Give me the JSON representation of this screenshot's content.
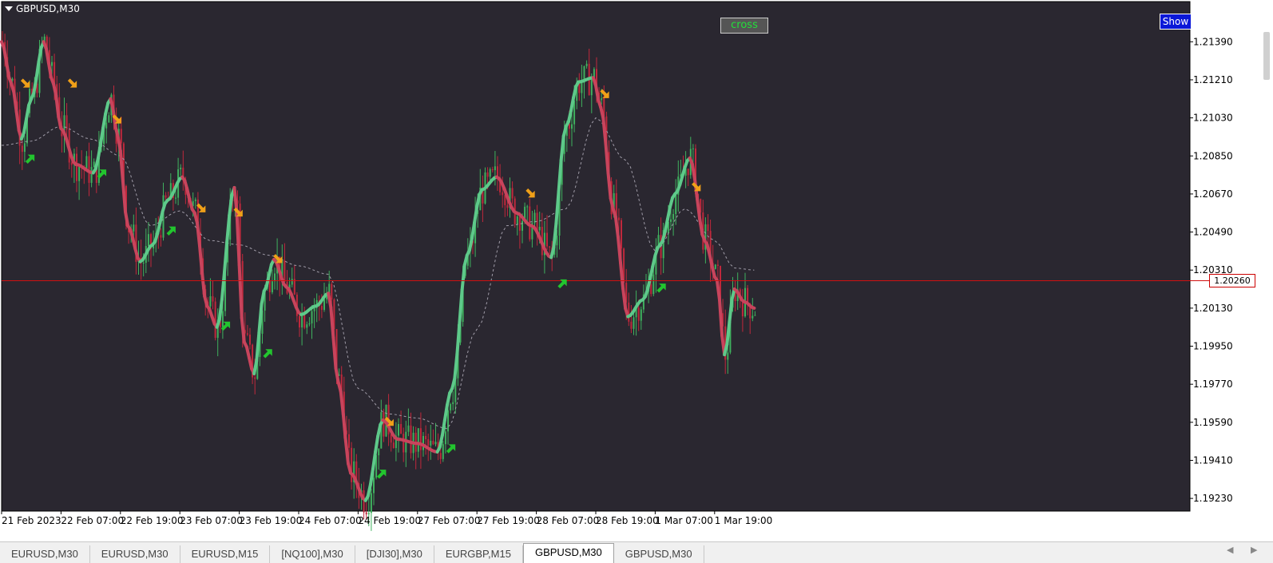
{
  "chart_title": "GBPUSD,M30",
  "show_button_label": "Show",
  "cross_label": "cross",
  "current_price_label": "1.20260",
  "colors": {
    "background": "#2a2730",
    "frame": "#ffffff",
    "axis_text": "#000000",
    "hline": "#d01010",
    "bull_candle": "#3fb15e",
    "bear_candle": "#c0283c",
    "trend_up": "#5ec98a",
    "trend_down": "#c8445c",
    "signal_buy": "#22c52e",
    "signal_sell": "#f0a018",
    "dashed_ma": "#a09ca8",
    "active_tab": "#ffffff"
  },
  "chart_data": {
    "type": "candlestick",
    "symbol": "GBPUSD",
    "timeframe": "M30",
    "y_ticks": [
      "1.21390",
      "1.21210",
      "1.21030",
      "1.20850",
      "1.20670",
      "1.20490",
      "1.20310",
      "1.20130",
      "1.19950",
      "1.19770",
      "1.19590",
      "1.19410",
      "1.19230"
    ],
    "ylim": [
      1.1917,
      1.2158
    ],
    "x_ticks": [
      "21 Feb 2023",
      "22 Feb 07:00",
      "22 Feb 19:00",
      "23 Feb 07:00",
      "23 Feb 19:00",
      "24 Feb 07:00",
      "24 Feb 19:00",
      "27 Feb 07:00",
      "27 Feb 19:00",
      "28 Feb 07:00",
      "28 Feb 19:00",
      "1 Mar 07:00",
      "1 Mar 19:00"
    ],
    "bars_per_tick": 24,
    "current_price": 1.2026,
    "smooth_line": [
      {
        "bar": 0,
        "price": 1.2139
      },
      {
        "bar": 4,
        "price": 1.2119
      },
      {
        "bar": 8,
        "price": 1.2093
      },
      {
        "bar": 12,
        "price": 1.2112
      },
      {
        "bar": 17,
        "price": 1.2139
      },
      {
        "bar": 21,
        "price": 1.2119
      },
      {
        "bar": 24,
        "price": 1.2098
      },
      {
        "bar": 30,
        "price": 1.2081
      },
      {
        "bar": 37,
        "price": 1.2077
      },
      {
        "bar": 44,
        "price": 1.2112
      },
      {
        "bar": 47,
        "price": 1.2094
      },
      {
        "bar": 51,
        "price": 1.2052
      },
      {
        "bar": 56,
        "price": 1.2035
      },
      {
        "bar": 61,
        "price": 1.2043
      },
      {
        "bar": 67,
        "price": 1.2064
      },
      {
        "bar": 73,
        "price": 1.2075
      },
      {
        "bar": 78,
        "price": 1.2058
      },
      {
        "bar": 83,
        "price": 1.2014
      },
      {
        "bar": 87,
        "price": 1.2004
      },
      {
        "bar": 94,
        "price": 1.207
      },
      {
        "bar": 98,
        "price": 1.1997
      },
      {
        "bar": 102,
        "price": 1.1982
      },
      {
        "bar": 106,
        "price": 1.2021
      },
      {
        "bar": 110,
        "price": 1.2036
      },
      {
        "bar": 115,
        "price": 1.2023
      },
      {
        "bar": 121,
        "price": 1.201
      },
      {
        "bar": 127,
        "price": 1.2014
      },
      {
        "bar": 132,
        "price": 1.202
      },
      {
        "bar": 136,
        "price": 1.1978
      },
      {
        "bar": 141,
        "price": 1.1935
      },
      {
        "bar": 147,
        "price": 1.1922
      },
      {
        "bar": 154,
        "price": 1.196
      },
      {
        "bar": 160,
        "price": 1.1951
      },
      {
        "bar": 168,
        "price": 1.1949
      },
      {
        "bar": 176,
        "price": 1.1945
      },
      {
        "bar": 182,
        "price": 1.1975
      },
      {
        "bar": 188,
        "price": 1.2038
      },
      {
        "bar": 194,
        "price": 1.2069
      },
      {
        "bar": 200,
        "price": 1.2075
      },
      {
        "bar": 208,
        "price": 1.2058
      },
      {
        "bar": 214,
        "price": 1.2052
      },
      {
        "bar": 222,
        "price": 1.2037
      },
      {
        "bar": 228,
        "price": 1.2099
      },
      {
        "bar": 233,
        "price": 1.212
      },
      {
        "bar": 239,
        "price": 1.2122
      },
      {
        "bar": 242,
        "price": 1.2108
      },
      {
        "bar": 247,
        "price": 1.206
      },
      {
        "bar": 253,
        "price": 1.2009
      },
      {
        "bar": 259,
        "price": 1.2017
      },
      {
        "bar": 266,
        "price": 1.2043
      },
      {
        "bar": 272,
        "price": 1.2067
      },
      {
        "bar": 278,
        "price": 1.2084
      },
      {
        "bar": 284,
        "price": 1.2045
      },
      {
        "bar": 289,
        "price": 1.2026
      },
      {
        "bar": 292,
        "price": 1.1991
      },
      {
        "bar": 296,
        "price": 1.2022
      },
      {
        "bar": 300,
        "price": 1.2016
      },
      {
        "bar": 304,
        "price": 1.2013
      }
    ],
    "slow_line": [
      {
        "bar": 0,
        "price": 1.209
      },
      {
        "bar": 12,
        "price": 1.2092
      },
      {
        "bar": 24,
        "price": 1.2099
      },
      {
        "bar": 36,
        "price": 1.2093
      },
      {
        "bar": 48,
        "price": 1.2085
      },
      {
        "bar": 60,
        "price": 1.2052
      },
      {
        "bar": 72,
        "price": 1.2059
      },
      {
        "bar": 84,
        "price": 1.2045
      },
      {
        "bar": 96,
        "price": 1.2043
      },
      {
        "bar": 108,
        "price": 1.2038
      },
      {
        "bar": 120,
        "price": 1.2033
      },
      {
        "bar": 132,
        "price": 1.2029
      },
      {
        "bar": 144,
        "price": 1.1975
      },
      {
        "bar": 156,
        "price": 1.1963
      },
      {
        "bar": 168,
        "price": 1.1961
      },
      {
        "bar": 180,
        "price": 1.1956
      },
      {
        "bar": 192,
        "price": 1.2003
      },
      {
        "bar": 204,
        "price": 1.2052
      },
      {
        "bar": 216,
        "price": 1.2054
      },
      {
        "bar": 228,
        "price": 1.206
      },
      {
        "bar": 240,
        "price": 1.2103
      },
      {
        "bar": 252,
        "price": 1.2083
      },
      {
        "bar": 264,
        "price": 1.204
      },
      {
        "bar": 276,
        "price": 1.206
      },
      {
        "bar": 288,
        "price": 1.2045
      },
      {
        "bar": 296,
        "price": 1.2032
      },
      {
        "bar": 304,
        "price": 1.2031
      }
    ],
    "buy_signals": [
      {
        "bar": 11,
        "price": 1.2084
      },
      {
        "bar": 40,
        "price": 1.2077
      },
      {
        "bar": 68,
        "price": 1.205
      },
      {
        "bar": 90,
        "price": 1.2005
      },
      {
        "bar": 107,
        "price": 1.1992
      },
      {
        "bar": 153,
        "price": 1.1935
      },
      {
        "bar": 181,
        "price": 1.1947
      },
      {
        "bar": 226,
        "price": 1.2025
      },
      {
        "bar": 266,
        "price": 1.2023
      }
    ],
    "sell_signals": [
      {
        "bar": 10,
        "price": 1.212
      },
      {
        "bar": 29,
        "price": 1.212
      },
      {
        "bar": 47,
        "price": 1.2103
      },
      {
        "bar": 81,
        "price": 1.2061
      },
      {
        "bar": 96,
        "price": 1.2059
      },
      {
        "bar": 112,
        "price": 1.2037
      },
      {
        "bar": 157,
        "price": 1.196
      },
      {
        "bar": 214,
        "price": 1.2068
      },
      {
        "bar": 244,
        "price": 1.2115
      },
      {
        "bar": 281,
        "price": 1.2071
      }
    ],
    "candle_seed": 7,
    "candle_count": 305
  },
  "tabs": [
    {
      "label": "EURUSD,M30",
      "active": false
    },
    {
      "label": "EURUSD,M30",
      "active": false
    },
    {
      "label": "EURUSD,M15",
      "active": false
    },
    {
      "label": "[NQ100],M30",
      "active": false
    },
    {
      "label": "[DJI30],M30",
      "active": false
    },
    {
      "label": "EURGBP,M15",
      "active": false
    },
    {
      "label": "GBPUSD,M30",
      "active": true
    },
    {
      "label": "GBPUSD,M30",
      "active": false
    }
  ],
  "tab_nav": {
    "left": "◀",
    "right": "▶"
  }
}
